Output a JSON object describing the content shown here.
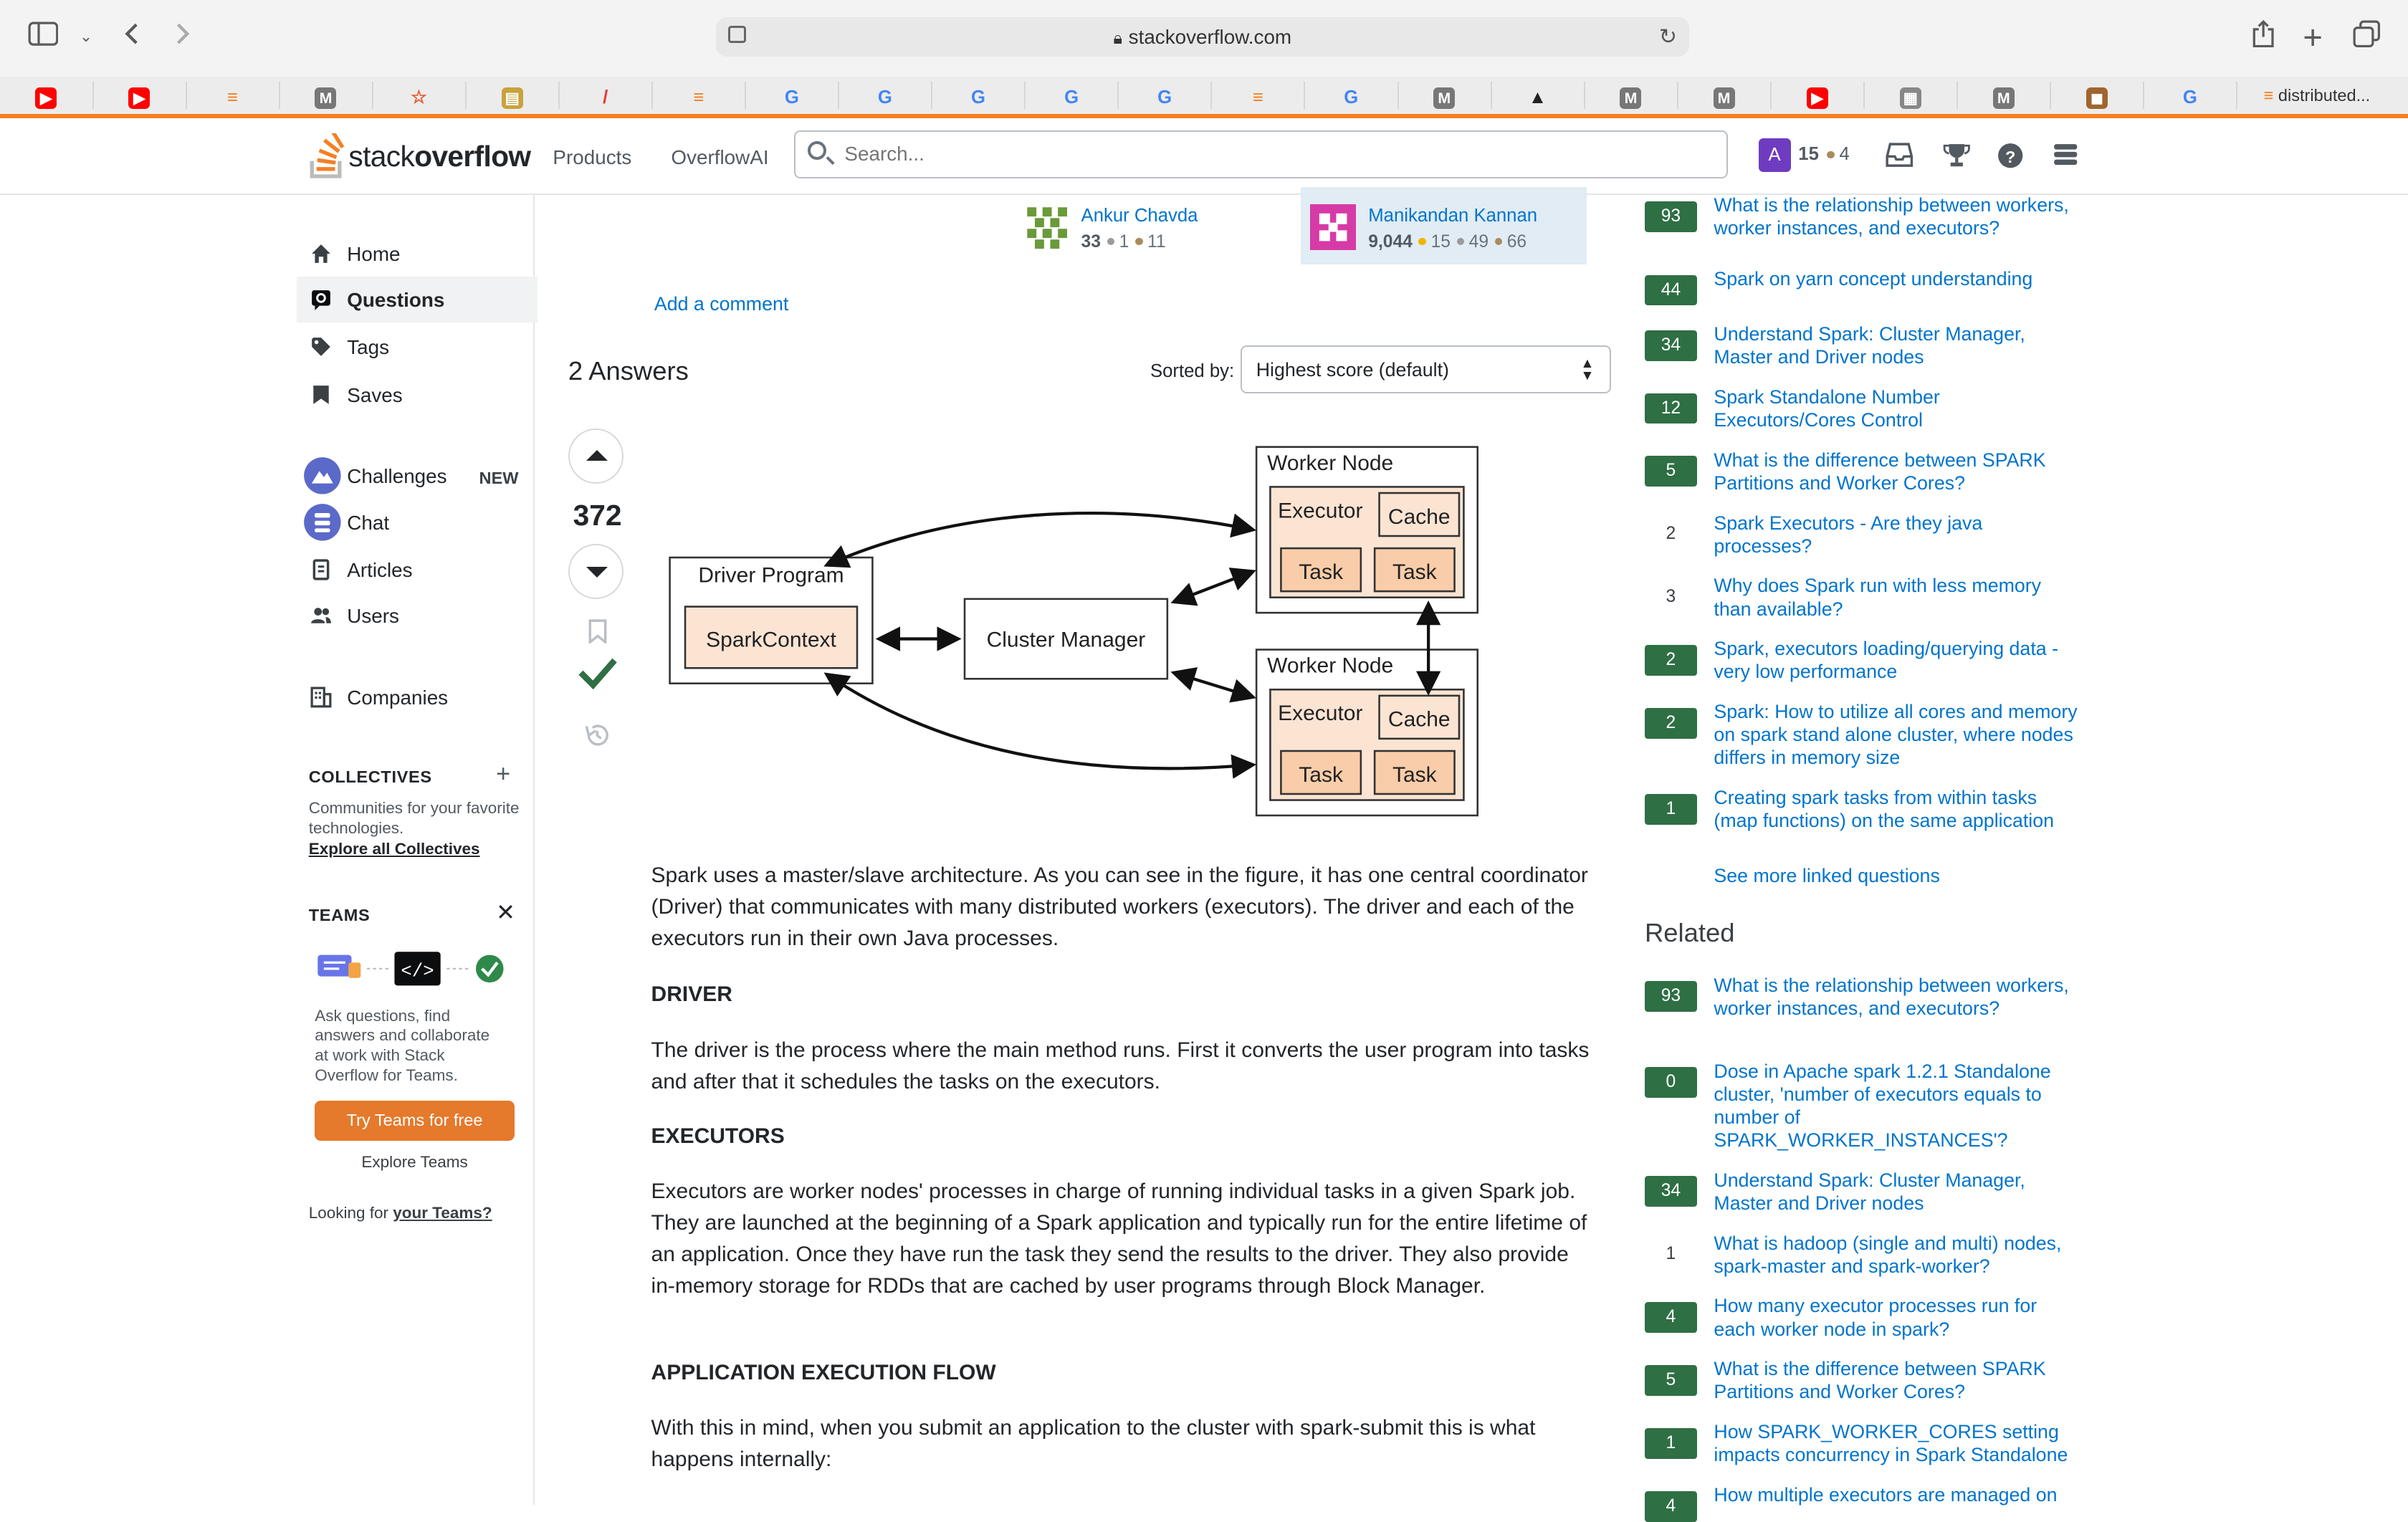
{
  "browser": {
    "url": "stackoverflow.com",
    "last_tab_label": "distributed...",
    "favorites": [
      {
        "icon": "youtube-icon",
        "color": "#ff0000",
        "glyph": "▶"
      },
      {
        "icon": "youtube-icon",
        "color": "#ff0000",
        "glyph": "▶"
      },
      {
        "icon": "stackoverflow-icon",
        "color": "#f48024",
        "glyph": "≡"
      },
      {
        "icon": "medium-icon",
        "color": "#777777",
        "glyph": "M"
      },
      {
        "icon": "star-icon",
        "color": "#e8552b",
        "glyph": "☆"
      },
      {
        "icon": "book-icon",
        "color": "#c9a23f",
        "glyph": "▤"
      },
      {
        "icon": "pen-icon",
        "color": "#e23b2e",
        "glyph": "/"
      },
      {
        "icon": "stackoverflow-icon",
        "color": "#f48024",
        "glyph": "≡"
      },
      {
        "icon": "google-icon",
        "color": "#4285f4",
        "glyph": "G"
      },
      {
        "icon": "google-icon",
        "color": "#4285f4",
        "glyph": "G"
      },
      {
        "icon": "google-icon",
        "color": "#4285f4",
        "glyph": "G"
      },
      {
        "icon": "google-icon",
        "color": "#4285f4",
        "glyph": "G"
      },
      {
        "icon": "google-icon",
        "color": "#4285f4",
        "glyph": "G"
      },
      {
        "icon": "stackoverflow-icon",
        "color": "#f48024",
        "glyph": "≡"
      },
      {
        "icon": "google-icon",
        "color": "#4285f4",
        "glyph": "G"
      },
      {
        "icon": "medium-icon",
        "color": "#777777",
        "glyph": "M"
      },
      {
        "icon": "graduation-cap-icon",
        "color": "#222222",
        "glyph": "▲"
      },
      {
        "icon": "medium-icon",
        "color": "#777777",
        "glyph": "M"
      },
      {
        "icon": "medium-icon",
        "color": "#777777",
        "glyph": "M"
      },
      {
        "icon": "youtube-icon",
        "color": "#ff0000",
        "glyph": "▶"
      },
      {
        "icon": "site-icon",
        "color": "#888888",
        "glyph": "▦"
      },
      {
        "icon": "medium-icon",
        "color": "#777777",
        "glyph": "M"
      },
      {
        "icon": "avatar-icon",
        "color": "#a0652f",
        "glyph": "◼"
      },
      {
        "icon": "google-icon",
        "color": "#4285f4",
        "glyph": "G"
      }
    ]
  },
  "header": {
    "logo_light": "stack",
    "logo_bold": "overflow",
    "products": "Products",
    "overflowai": "OverflowAI",
    "search_placeholder": "Search...",
    "avatar_letter": "A",
    "reputation": "15",
    "bronze_count": "4"
  },
  "leftnav": {
    "items": [
      {
        "label": "Home"
      },
      {
        "label": "Questions"
      },
      {
        "label": "Tags"
      },
      {
        "label": "Saves"
      },
      {
        "label": "Challenges"
      },
      {
        "label": "Chat"
      },
      {
        "label": "Articles"
      },
      {
        "label": "Users"
      },
      {
        "label": "Companies"
      }
    ],
    "new_badge": "NEW",
    "collectives_title": "COLLECTIVES",
    "collectives_desc": "Communities for your favorite technologies.",
    "collectives_link": "Explore all Collectives",
    "teams_title": "TEAMS",
    "teams_desc": "Ask questions, find answers and collaborate at work with Stack Overflow for Teams.",
    "try_teams": "Try Teams for free",
    "explore_teams": "Explore Teams",
    "looking_for": "Looking for",
    "your_teams": "your Teams?"
  },
  "question_users": [
    {
      "name": "Ankur Chavda",
      "rep": "33",
      "gold": "",
      "silver": "1",
      "bronze": "11"
    },
    {
      "name": "Manikandan Kannan",
      "rep": "9,044",
      "gold": "15",
      "silver": "49",
      "bronze": "66"
    }
  ],
  "main": {
    "add_comment": "Add a comment",
    "answers_title": "2 Answers",
    "sorted_by": "Sorted by:",
    "sort_value": "Highest score (default)",
    "score": "372"
  },
  "diagram": {
    "driver_program": "Driver Program",
    "spark_context": "SparkContext",
    "cluster_manager": "Cluster Manager",
    "worker_node": "Worker Node",
    "executor": "Executor",
    "cache": "Cache",
    "task": "Task"
  },
  "answer": {
    "p1": "Spark uses a master/slave architecture. As you can see in the figure, it has one central coordinator (Driver) that communicates with many distributed workers (executors). The driver and each of the executors run in their own Java processes.",
    "h_driver": "DRIVER",
    "p2": "The driver is the process where the main method runs. First it converts the user program into tasks and after that it schedules the tasks on the executors.",
    "h_executors": "EXECUTORS",
    "p3": "Executors are worker nodes' processes in charge of running individual tasks in a given Spark job. They are launched at the beginning of a Spark application and typically run for the entire lifetime of an application. Once they have run the task they send the results to the driver. They also provide in-memory storage for RDDs that are cached by user programs through Block Manager.",
    "h_flow": "APPLICATION EXECUTION FLOW",
    "p4": "With this in mind, when you submit an application to the cluster with spark-submit this is what happens internally:"
  },
  "linked": {
    "items": [
      {
        "score": "93",
        "accepted": true,
        "title": "What is the relationship between workers, worker instances, and executors?"
      },
      {
        "score": "44",
        "accepted": true,
        "title": "Spark on yarn concept understanding"
      },
      {
        "score": "34",
        "accepted": true,
        "title": "Understand Spark: Cluster Manager, Master and Driver nodes"
      },
      {
        "score": "12",
        "accepted": true,
        "title": "Spark Standalone Number Executors/Cores Control"
      },
      {
        "score": "5",
        "accepted": true,
        "title": "What is the difference between SPARK Partitions and Worker Cores?"
      },
      {
        "score": "2",
        "accepted": false,
        "title": "Spark Executors - Are they java processes?"
      },
      {
        "score": "3",
        "accepted": false,
        "title": "Why does Spark run with less memory than available?"
      },
      {
        "score": "2",
        "accepted": true,
        "title": "Spark, executors loading/querying data - very low performance"
      },
      {
        "score": "2",
        "accepted": true,
        "title": "Spark: How to utilize all cores and memory on spark stand alone cluster, where nodes differs in memory size"
      },
      {
        "score": "1",
        "accepted": true,
        "title": "Creating spark tasks from within tasks (map functions) on the same application"
      }
    ],
    "see_more": "See more linked questions"
  },
  "related": {
    "title": "Related",
    "items": [
      {
        "score": "93",
        "accepted": true,
        "title": "What is the relationship between workers, worker instances, and executors?"
      },
      {
        "score": "0",
        "accepted": true,
        "title": "Dose in Apache spark 1.2.1 Standalone cluster, 'number of executors equals to number of SPARK_WORKER_INSTANCES'?"
      },
      {
        "score": "34",
        "accepted": true,
        "title": "Understand Spark: Cluster Manager, Master and Driver nodes"
      },
      {
        "score": "1",
        "accepted": false,
        "title": "What is hadoop (single and multi) nodes, spark-master and spark-worker?"
      },
      {
        "score": "4",
        "accepted": true,
        "title": "How many executor processes run for each worker node in spark?"
      },
      {
        "score": "5",
        "accepted": true,
        "title": "What is the difference between SPARK Partitions and Worker Cores?"
      },
      {
        "score": "1",
        "accepted": true,
        "title": "How SPARK_WORKER_CORES setting impacts concurrency in Spark Standalone"
      },
      {
        "score": "4",
        "accepted": true,
        "title": "How multiple executors are managed on"
      }
    ]
  }
}
